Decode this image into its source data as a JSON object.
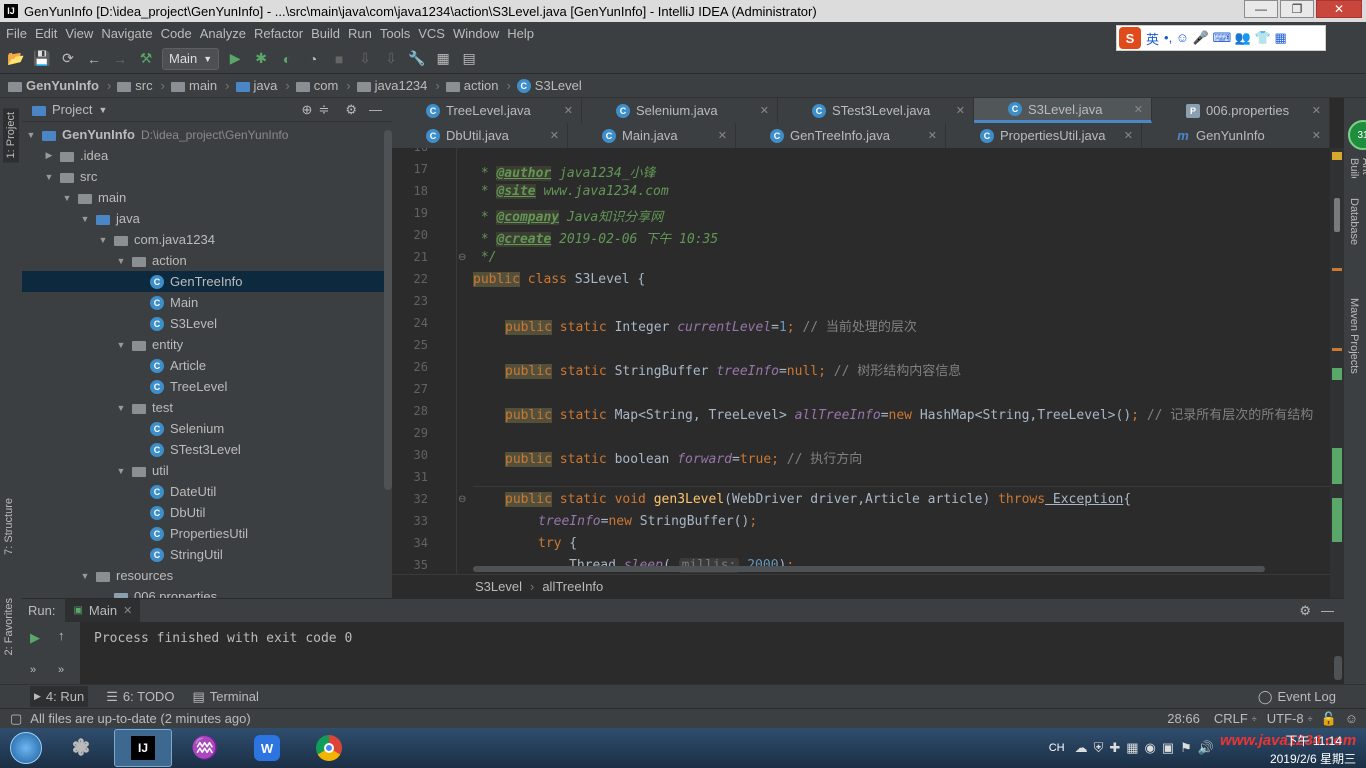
{
  "window": {
    "title": "GenYunInfo [D:\\idea_project\\GenYunInfo] - ...\\src\\main\\java\\com\\java1234\\action\\S3Level.java [GenYunInfo] - IntelliJ IDEA (Administrator)",
    "logo": "IJ",
    "minimize": "—",
    "maximize": "❐",
    "close": "✕"
  },
  "menu": [
    "File",
    "Edit",
    "View",
    "Navigate",
    "Code",
    "Analyze",
    "Refactor",
    "Build",
    "Run",
    "Tools",
    "VCS",
    "Window",
    "Help"
  ],
  "ime": {
    "logo": "S",
    "lang": "英",
    "symbols": "•, ☺ 🎤 ⌨ 👥 👕 ▦"
  },
  "toolbar": {
    "run_config": "Main"
  },
  "breadcrumbs": [
    "GenYunInfo",
    "src",
    "main",
    "java",
    "com",
    "java1234",
    "action",
    "S3Level"
  ],
  "project_panel": {
    "title": "Project",
    "tree": [
      {
        "label": "GenYunInfo",
        "hint": "D:\\idea_project\\GenYunInfo",
        "type": "module",
        "depth": 0,
        "arrow": "▼"
      },
      {
        "label": ".idea",
        "type": "folder",
        "depth": 1,
        "arrow": "▶"
      },
      {
        "label": "src",
        "type": "folder",
        "depth": 1,
        "arrow": "▼"
      },
      {
        "label": "main",
        "type": "folder",
        "depth": 2,
        "arrow": "▼"
      },
      {
        "label": "java",
        "type": "srcfolder",
        "depth": 3,
        "arrow": "▼"
      },
      {
        "label": "com.java1234",
        "type": "package",
        "depth": 4,
        "arrow": "▼"
      },
      {
        "label": "action",
        "type": "package",
        "depth": 5,
        "arrow": "▼"
      },
      {
        "label": "GenTreeInfo",
        "type": "class",
        "depth": 6,
        "selected": true
      },
      {
        "label": "Main",
        "type": "class",
        "depth": 6
      },
      {
        "label": "S3Level",
        "type": "class",
        "depth": 6
      },
      {
        "label": "entity",
        "type": "package",
        "depth": 5,
        "arrow": "▼"
      },
      {
        "label": "Article",
        "type": "class",
        "depth": 6
      },
      {
        "label": "TreeLevel",
        "type": "class",
        "depth": 6
      },
      {
        "label": "test",
        "type": "package",
        "depth": 5,
        "arrow": "▼"
      },
      {
        "label": "Selenium",
        "type": "class",
        "depth": 6
      },
      {
        "label": "STest3Level",
        "type": "class",
        "depth": 6
      },
      {
        "label": "util",
        "type": "package",
        "depth": 5,
        "arrow": "▼"
      },
      {
        "label": "DateUtil",
        "type": "class",
        "depth": 6
      },
      {
        "label": "DbUtil",
        "type": "class",
        "depth": 6
      },
      {
        "label": "PropertiesUtil",
        "type": "class",
        "depth": 6
      },
      {
        "label": "StringUtil",
        "type": "class",
        "depth": 6
      },
      {
        "label": "resources",
        "type": "resfolder",
        "depth": 3,
        "arrow": "▼"
      },
      {
        "label": "006.properties",
        "type": "file",
        "depth": 4
      }
    ]
  },
  "tabs_row1": [
    {
      "label": "TreeLevel.java",
      "icon": "C"
    },
    {
      "label": "Selenium.java",
      "icon": "C"
    },
    {
      "label": "STest3Level.java",
      "icon": "C"
    },
    {
      "label": "S3Level.java",
      "icon": "C",
      "active": true
    },
    {
      "label": "006.properties",
      "icon": "P"
    }
  ],
  "tabs_row2": [
    {
      "label": "DbUtil.java",
      "icon": "C"
    },
    {
      "label": "Main.java",
      "icon": "C"
    },
    {
      "label": "GenTreeInfo.java",
      "icon": "C"
    },
    {
      "label": "PropertiesUtil.java",
      "icon": "C"
    },
    {
      "label": "GenYunInfo",
      "icon": "m"
    }
  ],
  "editor": {
    "line_numbers": [
      "16",
      "17",
      "18",
      "19",
      "20",
      "21",
      "22",
      "23",
      "24",
      "25",
      "26",
      "27",
      "28",
      "29",
      "30",
      "31",
      "32",
      "33",
      "34",
      "35"
    ],
    "l17_tag": "@author",
    "l17_text": " java1234_小锋",
    "l18_tag": "@site",
    "l18_text": " www.java1234.com",
    "l19_tag": "@company",
    "l19_text": " Java知识分享网",
    "l20_tag": "@create",
    "l20_text": " 2019-02-06 下午 10:35",
    "l21": " */",
    "l22_public": "public",
    "l22_class": " class",
    "l22_rest": " S3Level {",
    "l24_public": "public",
    "l24_static": " static",
    "l24_type": " Integer ",
    "l24_field": "currentLevel",
    "l24_eq": "=",
    "l24_val": "1",
    "l24_semi": ";",
    "l24_comment": " // 当前处理的层次",
    "l26_public": "public",
    "l26_static": " static",
    "l26_type": " StringBuffer ",
    "l26_field": "treeInfo",
    "l26_eq": "=",
    "l26_val": "null",
    "l26_semi": ";",
    "l26_comment": " // 树形结构内容信息",
    "l28_public": "public",
    "l28_static": " static",
    "l28_type": " Map<String, TreeLevel> ",
    "l28_field": "allTreeInfo",
    "l28_eq": "=",
    "l28_new": "new",
    "l28_rest": " HashMap<String,TreeLevel>()",
    "l28_semi": ";",
    "l28_comment": " // 记录所有层次的所有结构",
    "l30_public": "public",
    "l30_static": " static",
    "l30_type": " boolean ",
    "l30_field": "forward",
    "l30_eq": "=",
    "l30_val": "true",
    "l30_semi": ";",
    "l30_comment": " // 执行方向",
    "l32_public": "public",
    "l32_kws": " static void ",
    "l32_fn": "gen3Level",
    "l32_params": "(WebDriver driver,Article article) ",
    "l32_throws": "throws",
    "l32_exc": " Exception",
    "l32_brace": "{",
    "l33_field": "treeInfo",
    "l33_eq": "=",
    "l33_new": "new",
    "l33_rest": " StringBuffer()",
    "l33_semi": ";",
    "l34_try": "try",
    "l34_rest": " {",
    "l35_call": "Thread.",
    "l35_method": "sleep",
    "l35_open": "( ",
    "l35_hint": "millis:",
    "l35_val": " 2000",
    "l35_close": ")",
    "l35_semi": ";"
  },
  "editor_breadcrumb": [
    "S3Level",
    "allTreeInfo"
  ],
  "run_panel": {
    "title": "Run:",
    "tab": "Main",
    "output": "Process finished with exit code 0"
  },
  "bottom_tabs": [
    "4: Run",
    "6: TODO",
    "Terminal"
  ],
  "event_log": "Event Log",
  "left_vtabs": [
    "1: Project",
    "7: Structure",
    "2: Favorites"
  ],
  "right_vtabs": [
    "Ant Build",
    "Database",
    "Maven Projects"
  ],
  "status": {
    "message": "All files are up-to-date (2 minutes ago)",
    "position": "28:66",
    "line_sep": "CRLF",
    "encoding": "UTF-8"
  },
  "taskbar": {
    "lang": "CH",
    "time": "下午 11:14",
    "date": "2019/2/6 星期三",
    "watermark": "www.java1234.com"
  },
  "colors": {
    "accent": "#4a88c7",
    "keyword": "#cc7832",
    "field": "#9876aa",
    "doc": "#629755",
    "selection": "#0d293e"
  }
}
